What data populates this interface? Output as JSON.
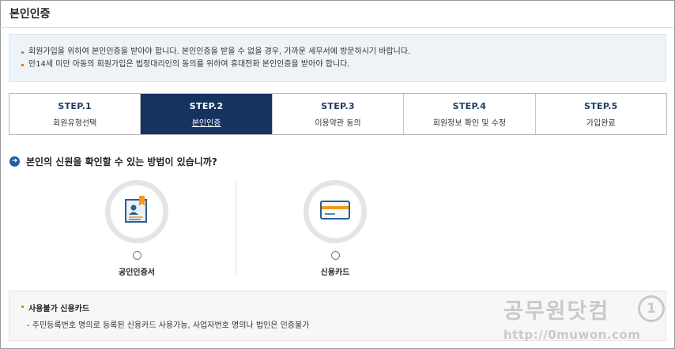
{
  "page": {
    "title": "본인인증"
  },
  "notice": [
    "회원가입을 위하여 본인인증을 받아야 합니다. 본인인증을 받을 수 없을 경우, 가까운 세무서에 방문하시기 바랍니다.",
    "만14세 미만 아동의 회원가입은 법정대리인의 동의를 위하여 휴대전화 본인인증을 받아야 합니다."
  ],
  "steps": [
    {
      "num": "STEP.1",
      "label": "회원유형선택"
    },
    {
      "num": "STEP.2",
      "label": "본인인증"
    },
    {
      "num": "STEP.3",
      "label": "이용약관 동의"
    },
    {
      "num": "STEP.4",
      "label": "회원정보 확인 및 수정"
    },
    {
      "num": "STEP.5",
      "label": "가입완료"
    }
  ],
  "active_step": 2,
  "question": {
    "icon": "arrow-right-circle-icon",
    "text": "본인의 신원을 확인할 수 있는 방법이 있습니까?"
  },
  "options": [
    {
      "label": "공인인증서",
      "icon": "certificate-icon"
    },
    {
      "label": "신용카드",
      "icon": "credit-card-icon"
    }
  ],
  "info": {
    "title": "사용불가 신용카드",
    "desc": "- 주민등록번호 명의로 등록된 신용카드 사용가능, 사업자번호 명의나 법인은 인증불가"
  },
  "watermark": {
    "text": "공무원닷컴",
    "url": "http://0muwon.com",
    "badge": "1"
  },
  "colors": {
    "active_step_bg": "#15335e",
    "step_text": "#1d3c66",
    "bullet": "#f07a00",
    "notice_bg": "#eef3f8"
  }
}
